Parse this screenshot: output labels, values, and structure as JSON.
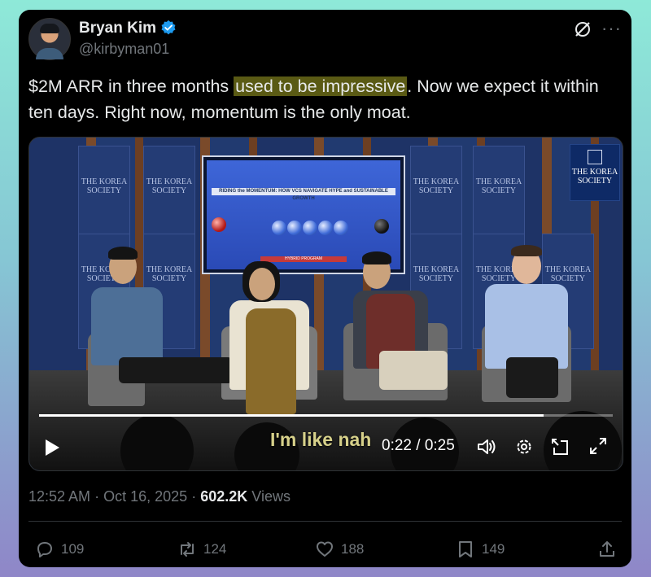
{
  "author": {
    "name": "Bryan Kim",
    "handle": "@kirbyman01",
    "verified": true
  },
  "tweet": {
    "text_before": "$2M ARR in three months ",
    "text_highlight": "used to be impressive",
    "text_after": ". Now we expect it within ten days. Right now, momentum is the only moat."
  },
  "video": {
    "banner_text": "THE KOREA SOCIETY",
    "logo_text": "THE KOREA SOCIETY",
    "screen_headline": "RIDING the MOMENTUM: HOW VCS NAVIGATE HYPE and SUSTAINABLE GROWTH",
    "screen_program": "HYBRID PROGRAM",
    "caption": "I'm like nah",
    "time": "0:22 / 0:25",
    "progress": 0.88,
    "icons": [
      "play-icon",
      "volume-icon",
      "settings-icon",
      "picture-in-picture-icon",
      "fullscreen-icon"
    ]
  },
  "meta": {
    "time": "12:52 AM",
    "separator": "·",
    "date": "Oct 16, 2025",
    "views_count": "602.2K",
    "views_label": "Views"
  },
  "actions": {
    "replies": "109",
    "reposts": "124",
    "likes": "188",
    "bookmarks": "149"
  },
  "colors": {
    "background": "#000000",
    "text": "#e7e9ea",
    "muted": "#71767b",
    "verified": "#1d9bf0",
    "highlight": "#5a5a14"
  }
}
